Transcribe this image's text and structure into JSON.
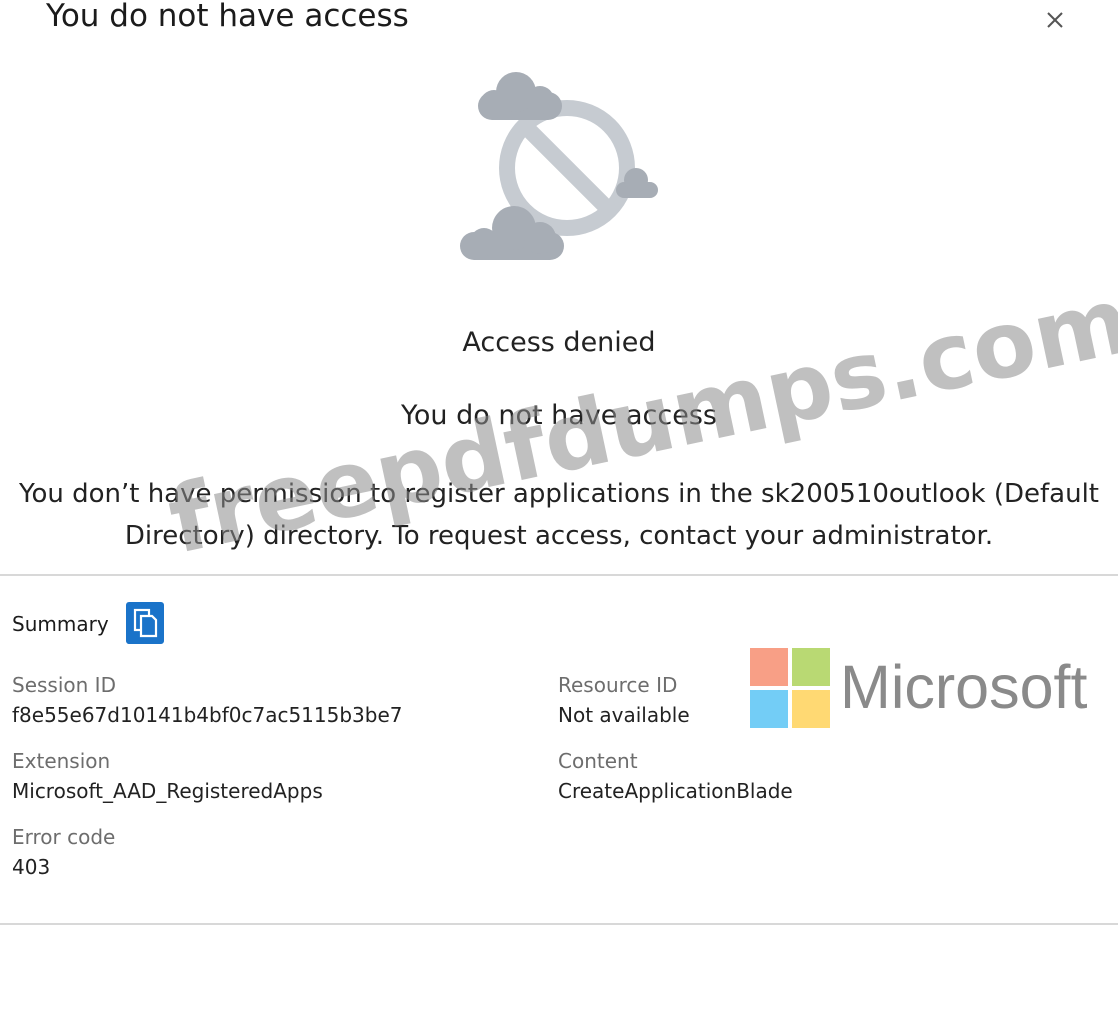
{
  "blade": {
    "title": "You do not have access",
    "close_icon": "close-icon"
  },
  "illustration": {
    "icon": "access-denied-icon",
    "cloud_color": "#a7adb5",
    "ring_color": "#c6cbd1"
  },
  "main": {
    "heading": "Access denied",
    "subheading": "You do not have access",
    "message_line1": "You don’t have permission to register applications in the sk200510outlook (Default",
    "message_line2": "Directory) directory. To request access, contact your administrator."
  },
  "summary": {
    "label": "Summary",
    "copy_icon": "copy-icon",
    "copy_button_color": "#1a73c9",
    "fields": {
      "session_id_label": "Session ID",
      "session_id_value": "f8e55e67d10141b4bf0c7ac5115b3be7",
      "resource_id_label": "Resource ID",
      "resource_id_value": "Not available",
      "extension_label": "Extension",
      "extension_value": "Microsoft_AAD_RegisteredApps",
      "content_label": "Content",
      "content_value": "CreateApplicationBlade",
      "error_code_label": "Error code",
      "error_code_value": "403"
    }
  },
  "branding": {
    "wordmark": "Microsoft",
    "logo_colors": [
      "#f25022",
      "#7fba00",
      "#00a4ef",
      "#ffb900"
    ]
  },
  "watermark": {
    "text": "freepdfdumps.com"
  }
}
